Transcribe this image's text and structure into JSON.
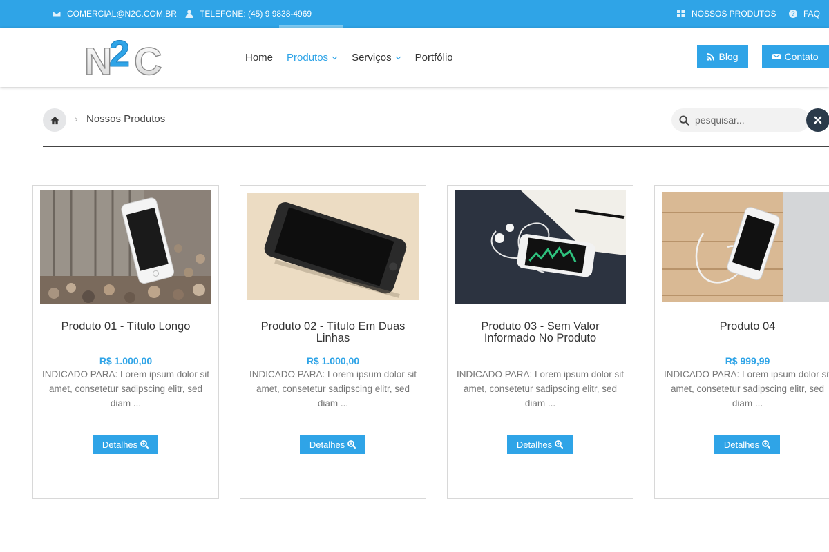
{
  "topbar": {
    "email": "COMERCIAL@N2C.COM.BR",
    "phone": "TELEFONE: (45) 9 9838-4969",
    "products_link": "NOSSOS PRODUTOS",
    "faq_link": "FAQ"
  },
  "brand": {
    "logo_text": "N2C",
    "accent_color": "#2fa4e7"
  },
  "nav": {
    "home": "Home",
    "produtos": "Produtos",
    "servicos": "Serviços",
    "portfolio": "Portfólio"
  },
  "header_buttons": {
    "blog": "Blog",
    "contato": "Contato"
  },
  "breadcrumb": {
    "current": "Nossos Produtos"
  },
  "search": {
    "placeholder": "pesquisar..."
  },
  "products": [
    {
      "title": "Produto 01 - Título Longo",
      "price": "R$ 1.000,00",
      "description": "INDICADO PARA: Lorem ipsum dolor sit amet, consetetur sadipscing elitr, sed diam ...",
      "button": "Detalhes"
    },
    {
      "title": "Produto 02 - Título Em Duas Linhas",
      "price": "R$ 1.000,00",
      "description": "INDICADO PARA: Lorem ipsum dolor sit amet, consetetur sadipscing elitr, sed diam ...",
      "button": "Detalhes"
    },
    {
      "title": "Produto 03 - Sem Valor Informado No Produto",
      "price": "",
      "description": "INDICADO PARA: Lorem ipsum dolor sit amet, consetetur sadipscing elitr, sed diam ...",
      "button": "Detalhes"
    },
    {
      "title": "Produto 04",
      "price": "R$ 999,99",
      "description": "INDICADO PARA: Lorem ipsum dolor sit amet, consetetur sadipscing elitr, sed diam ...",
      "button": "Detalhes"
    }
  ]
}
